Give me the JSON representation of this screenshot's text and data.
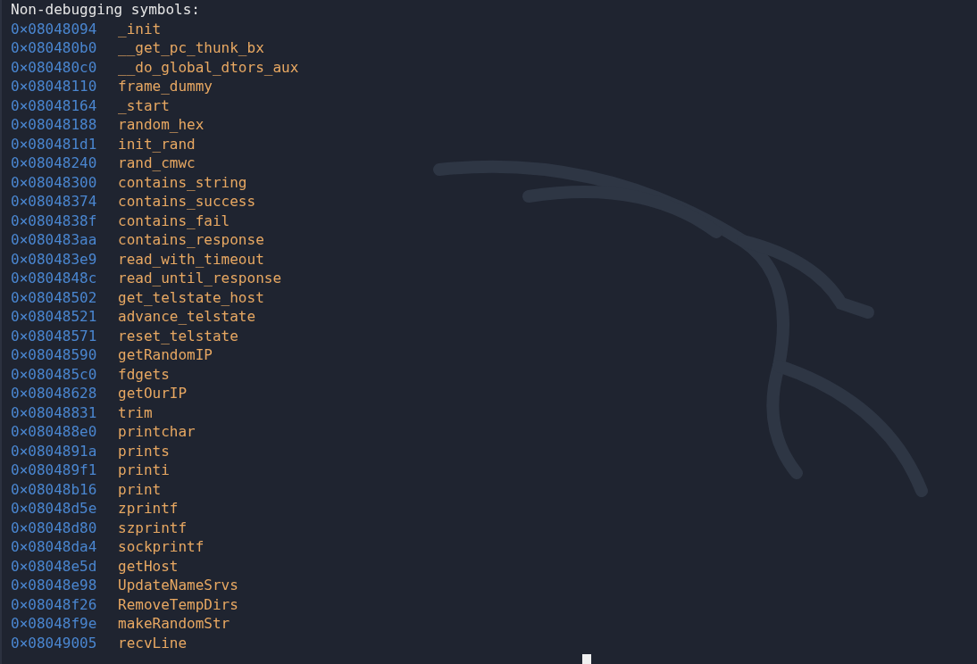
{
  "header": "Non-debugging symbols:",
  "symbols": [
    {
      "address": "0×08048094",
      "name": "_init"
    },
    {
      "address": "0×080480b0",
      "name": "__get_pc_thunk_bx"
    },
    {
      "address": "0×080480c0",
      "name": "__do_global_dtors_aux"
    },
    {
      "address": "0×08048110",
      "name": "frame_dummy"
    },
    {
      "address": "0×08048164",
      "name": "_start"
    },
    {
      "address": "0×08048188",
      "name": "random_hex"
    },
    {
      "address": "0×080481d1",
      "name": "init_rand"
    },
    {
      "address": "0×08048240",
      "name": "rand_cmwc"
    },
    {
      "address": "0×08048300",
      "name": "contains_string"
    },
    {
      "address": "0×08048374",
      "name": "contains_success"
    },
    {
      "address": "0×0804838f",
      "name": "contains_fail"
    },
    {
      "address": "0×080483aa",
      "name": "contains_response"
    },
    {
      "address": "0×080483e9",
      "name": "read_with_timeout"
    },
    {
      "address": "0×0804848c",
      "name": "read_until_response"
    },
    {
      "address": "0×08048502",
      "name": "get_telstate_host"
    },
    {
      "address": "0×08048521",
      "name": "advance_telstate"
    },
    {
      "address": "0×08048571",
      "name": "reset_telstate"
    },
    {
      "address": "0×08048590",
      "name": "getRandomIP"
    },
    {
      "address": "0×080485c0",
      "name": "fdgets"
    },
    {
      "address": "0×08048628",
      "name": "getOurIP"
    },
    {
      "address": "0×08048831",
      "name": "trim"
    },
    {
      "address": "0×080488e0",
      "name": "printchar"
    },
    {
      "address": "0×0804891a",
      "name": "prints"
    },
    {
      "address": "0×080489f1",
      "name": "printi"
    },
    {
      "address": "0×08048b16",
      "name": "print"
    },
    {
      "address": "0×08048d5e",
      "name": "zprintf"
    },
    {
      "address": "0×08048d80",
      "name": "szprintf"
    },
    {
      "address": "0×08048da4",
      "name": "sockprintf"
    },
    {
      "address": "0×08048e5d",
      "name": "getHost"
    },
    {
      "address": "0×08048e98",
      "name": "UpdateNameSrvs"
    },
    {
      "address": "0×08048f26",
      "name": "RemoveTempDirs"
    },
    {
      "address": "0×08048f9e",
      "name": "makeRandomStr"
    },
    {
      "address": "0×08049005",
      "name": "recvLine"
    }
  ]
}
